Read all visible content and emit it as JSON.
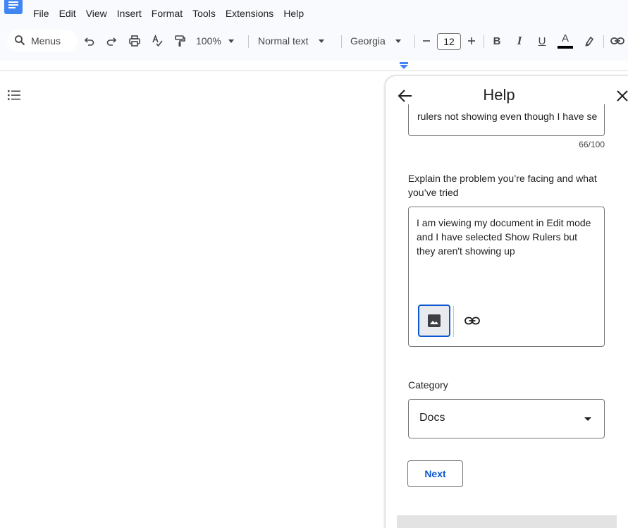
{
  "menubar": {
    "items": [
      "File",
      "Edit",
      "View",
      "Insert",
      "Format",
      "Tools",
      "Extensions",
      "Help"
    ]
  },
  "toolbar": {
    "search_label": "Menus",
    "zoom": "100%",
    "style": "Normal text",
    "font": "Georgia",
    "font_size": "12",
    "bold": "B",
    "italic": "I",
    "underline": "U",
    "text_color": "A"
  },
  "help": {
    "title": "Help",
    "summary_value": "rulers not showing even though I have selected Show Rulers",
    "char_count": "66/100",
    "explain_label": "Explain the problem you’re facing and what you’ve tried",
    "explain_value": "I am viewing my document in Edit mode and I have selected Show Rulers but they aren't showing up",
    "category_label": "Category",
    "category_value": "Docs",
    "next_label": "Next"
  },
  "colors": {
    "accent": "#0b57d0",
    "docs_blue": "#4285f4",
    "top_background": "#f8fafd"
  },
  "icons": {
    "search": "search-icon",
    "undo": "undo-icon",
    "redo": "redo-icon",
    "print": "print-icon",
    "spellcheck": "spellcheck-icon",
    "paint_format": "paint-format-icon",
    "highlight": "highlight-pen-icon",
    "link": "link-icon",
    "outline": "document-outline-icon",
    "back": "arrow-back-icon",
    "close": "close-icon",
    "image": "image-icon"
  }
}
